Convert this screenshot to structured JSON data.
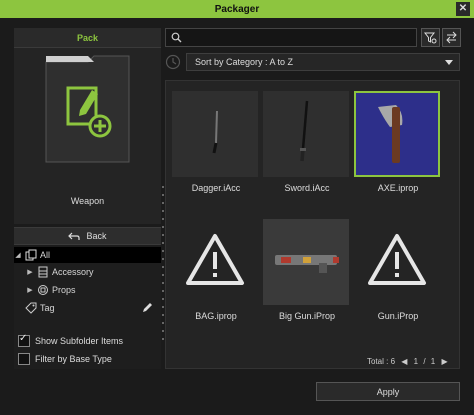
{
  "window": {
    "title": "Packager",
    "close_glyph": "✕"
  },
  "left": {
    "tab_label": "Pack",
    "pack_name": "Weapon",
    "back_label": "Back",
    "tree": [
      {
        "label": "All",
        "icon": "copy-icon",
        "selected": true
      },
      {
        "label": "Accessory",
        "icon": "accessory-icon",
        "selected": false
      },
      {
        "label": "Props",
        "icon": "props-icon",
        "selected": false
      },
      {
        "label": "Tag",
        "icon": "tag-icon",
        "selected": false
      }
    ],
    "options": [
      {
        "label": "Show Subfolder Items",
        "checked": true
      },
      {
        "label": "Filter by Base Type",
        "checked": false
      }
    ]
  },
  "search": {
    "placeholder": "",
    "value": ""
  },
  "sort": {
    "selected": "Sort by Category : A to Z"
  },
  "items": [
    {
      "label": "Dagger.iAcc",
      "type": "dagger",
      "selected": false
    },
    {
      "label": "Sword.iAcc",
      "type": "sword",
      "selected": false
    },
    {
      "label": "AXE.iprop",
      "type": "axe",
      "selected": true
    },
    {
      "label": "BAG.iprop",
      "type": "warning",
      "selected": false
    },
    {
      "label": "Big Gun.iProp",
      "type": "gun",
      "selected": false
    },
    {
      "label": "Gun.iProp",
      "type": "warning",
      "selected": false
    }
  ],
  "footer": {
    "total": "Total : 6",
    "page_current": "1",
    "page_sep": "/",
    "page_total": "1"
  },
  "apply_label": "Apply",
  "colors": {
    "accent": "#8dc53f",
    "background": "#1b1b1b",
    "axe_bg": "#2d2f8a"
  }
}
